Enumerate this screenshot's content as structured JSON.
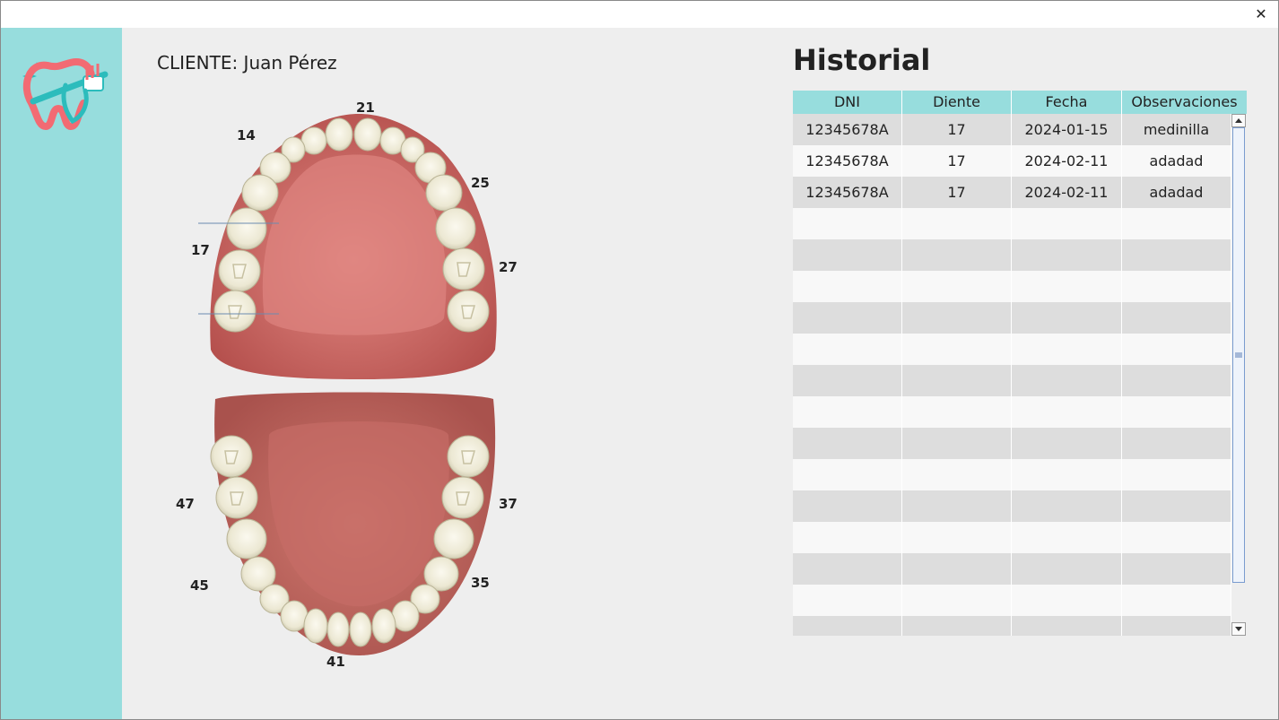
{
  "window": {
    "close_label": "✕"
  },
  "client": {
    "label": "CLIENTE: Juan Pérez"
  },
  "odontogram": {
    "tooth_numbers": [
      "21",
      "14",
      "25",
      "17",
      "27",
      "47",
      "37",
      "45",
      "35",
      "41"
    ]
  },
  "history": {
    "title": "Historial",
    "columns": [
      "DNI",
      "Diente",
      "Fecha",
      "Observaciones"
    ],
    "rows": [
      [
        "12345678A",
        "17",
        "2024-01-15",
        "medinilla"
      ],
      [
        "12345678A",
        "17",
        "2024-02-11",
        "adadad"
      ],
      [
        "12345678A",
        "17",
        "2024-02-11",
        "adadad"
      ]
    ]
  },
  "colors": {
    "accent": "#97dddd",
    "gum": "#c8645e",
    "tooth": "#f4f1e4"
  }
}
